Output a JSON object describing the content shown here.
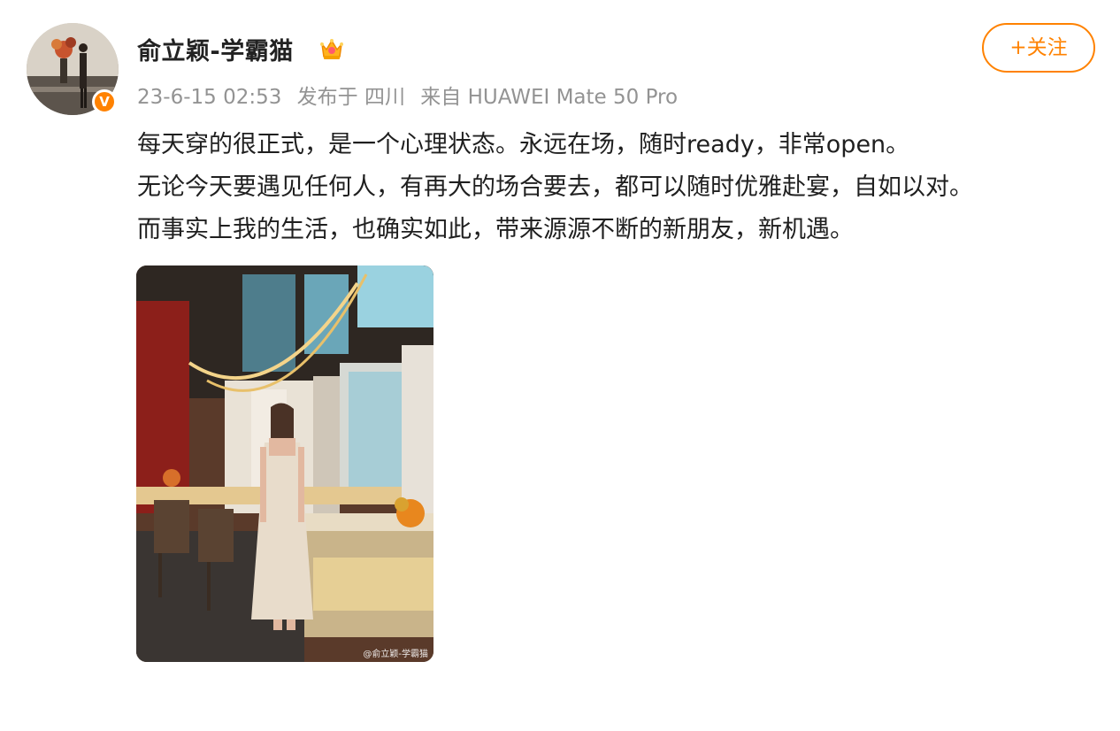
{
  "post": {
    "author": {
      "name": "俞立颖-学霸猫",
      "badge_icon": "crown-icon",
      "verified_icon": "verified-v-icon",
      "verified_text": "V"
    },
    "meta": {
      "time": "23-6-15 02:53",
      "location": "发布于 四川",
      "source": "来自 HUAWEI Mate 50 Pro"
    },
    "follow_label": "+关注",
    "text_lines": [
      "每天穿的很正式，是一个心理状态。永远在场，随时ready，非常open。",
      "无论今天要遇见任何人，有再大的场合要去，都可以随时优雅赴宴，自如以对。",
      "而事实上我的生活，也确实如此，带来源源不断的新朋友，新机遇。"
    ],
    "image": {
      "watermark": "@俞立颖-学霸猫"
    }
  },
  "colors": {
    "accent": "#ff8200",
    "meta": "#939393",
    "text": "#1f1f1f"
  }
}
